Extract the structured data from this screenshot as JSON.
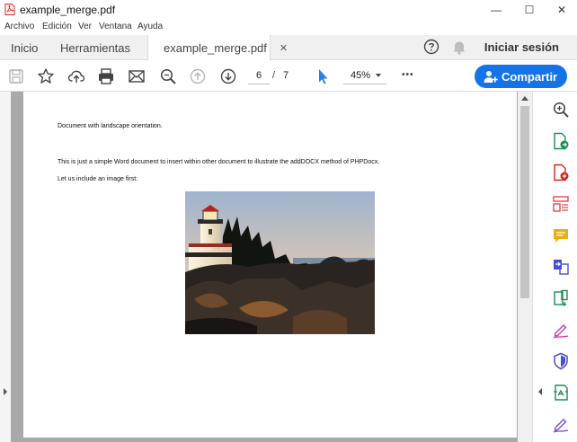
{
  "window": {
    "title": "example_merge.pdf",
    "minimize": "—",
    "maximize": "☐",
    "close": "✕"
  },
  "menu": [
    "Archivo",
    "Edición",
    "Ver",
    "Ventana",
    "Ayuda"
  ],
  "tabs": {
    "home": "Inicio",
    "tools": "Herramientas",
    "document": "example_merge.pdf",
    "close_glyph": "✕",
    "sign_in": "Iniciar sesión"
  },
  "toolbar": {
    "current_page": "6",
    "page_separator": "/",
    "total_pages": "7",
    "zoom": "45%",
    "more": "•••",
    "share_label": "Compartir"
  },
  "document": {
    "line1": "Document with landscape orientation.",
    "line2": "This is just a simple Word document to insert within other document to illustrate the addDOCX method of PHPDocx.",
    "line3": "Let us include an image first:"
  },
  "colors": {
    "accent": "#1473e6",
    "viewer_bg": "#a9a9a9"
  },
  "right_tools": [
    "zoom-icon",
    "export-pdf-icon",
    "create-pdf-icon",
    "organize-pages-icon",
    "comment-icon",
    "combine-files-icon",
    "compress-icon",
    "fill-sign-icon",
    "protect-icon",
    "scan-icon",
    "edit-pdf-icon"
  ]
}
